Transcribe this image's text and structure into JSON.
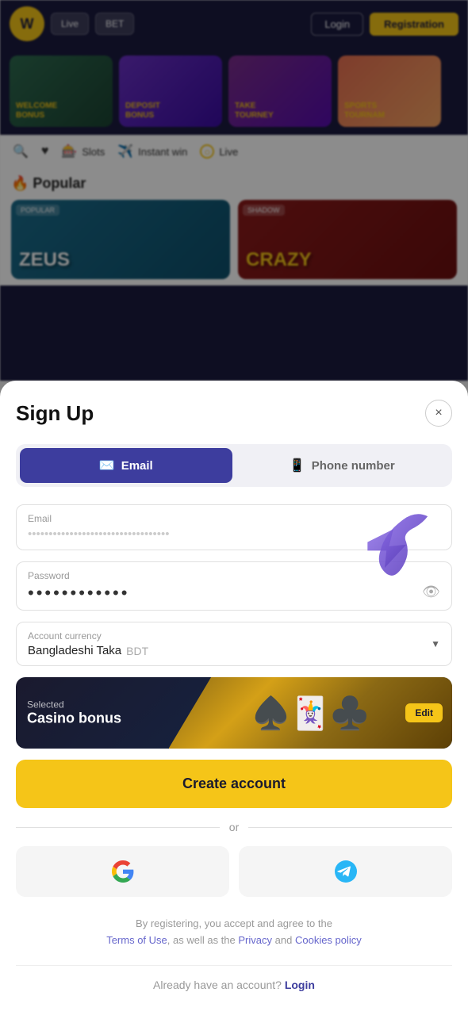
{
  "site": {
    "logo_text": "W",
    "nav": {
      "btn1": "Live",
      "btn2": "BET",
      "login_label": "Login",
      "register_label": "Registration"
    },
    "banners": [
      {
        "label": "WELCOME\nBONUS",
        "color1": "#2d6a4f",
        "color2": "#1b4332"
      },
      {
        "label": "DEPOSIT\nBONUS",
        "color1": "#6930c3",
        "color2": "#3a0ca3"
      },
      {
        "label": "TAKE\nTOURNEY",
        "color1": "#7b2d8b",
        "color2": "#560bad"
      },
      {
        "label": "SPORTS\nTOURNAM",
        "color1": "#e76f51",
        "color2": "#f4a261"
      }
    ],
    "categories": [
      {
        "icon": "🔍",
        "label": ""
      },
      {
        "icon": "♥",
        "label": ""
      },
      {
        "icon": "🎰",
        "label": "Slots"
      },
      {
        "icon": "✈️",
        "label": "Instant win"
      },
      {
        "icon": "⊙",
        "label": "Live"
      }
    ],
    "popular_title": "🔥 Popular",
    "games": [
      {
        "text": "ZEUS",
        "badge": "POPULAR"
      },
      {
        "text": "CRAZY",
        "badge": "SHADOW"
      }
    ]
  },
  "modal": {
    "title": "Sign Up",
    "close_label": "×",
    "tabs": [
      {
        "id": "email",
        "label": "Email",
        "active": true
      },
      {
        "id": "phone",
        "label": "Phone number",
        "active": false
      }
    ],
    "email_field": {
      "label": "Email",
      "placeholder": "••••••••••••••••••••••••••••••••••"
    },
    "password_field": {
      "label": "Password",
      "value": "••••••••••••"
    },
    "currency_field": {
      "label": "Account currency",
      "currency_name": "Bangladeshi Taka",
      "currency_code": "BDT"
    },
    "bonus": {
      "selected_label": "Selected",
      "title": "Casino bonus",
      "edit_label": "Edit"
    },
    "create_account_label": "Create account",
    "or_label": "or",
    "social": {
      "google_label": "G",
      "telegram_label": "✈"
    },
    "terms": {
      "prefix": "By registering, you accept and agree to the",
      "terms_label": "Terms of Use",
      "middle": ", as well as the",
      "privacy_label": "Privacy",
      "and": "and",
      "cookies_label": "Cookies policy"
    },
    "already": {
      "prefix": "Already have an account?",
      "login_label": "Login"
    }
  }
}
